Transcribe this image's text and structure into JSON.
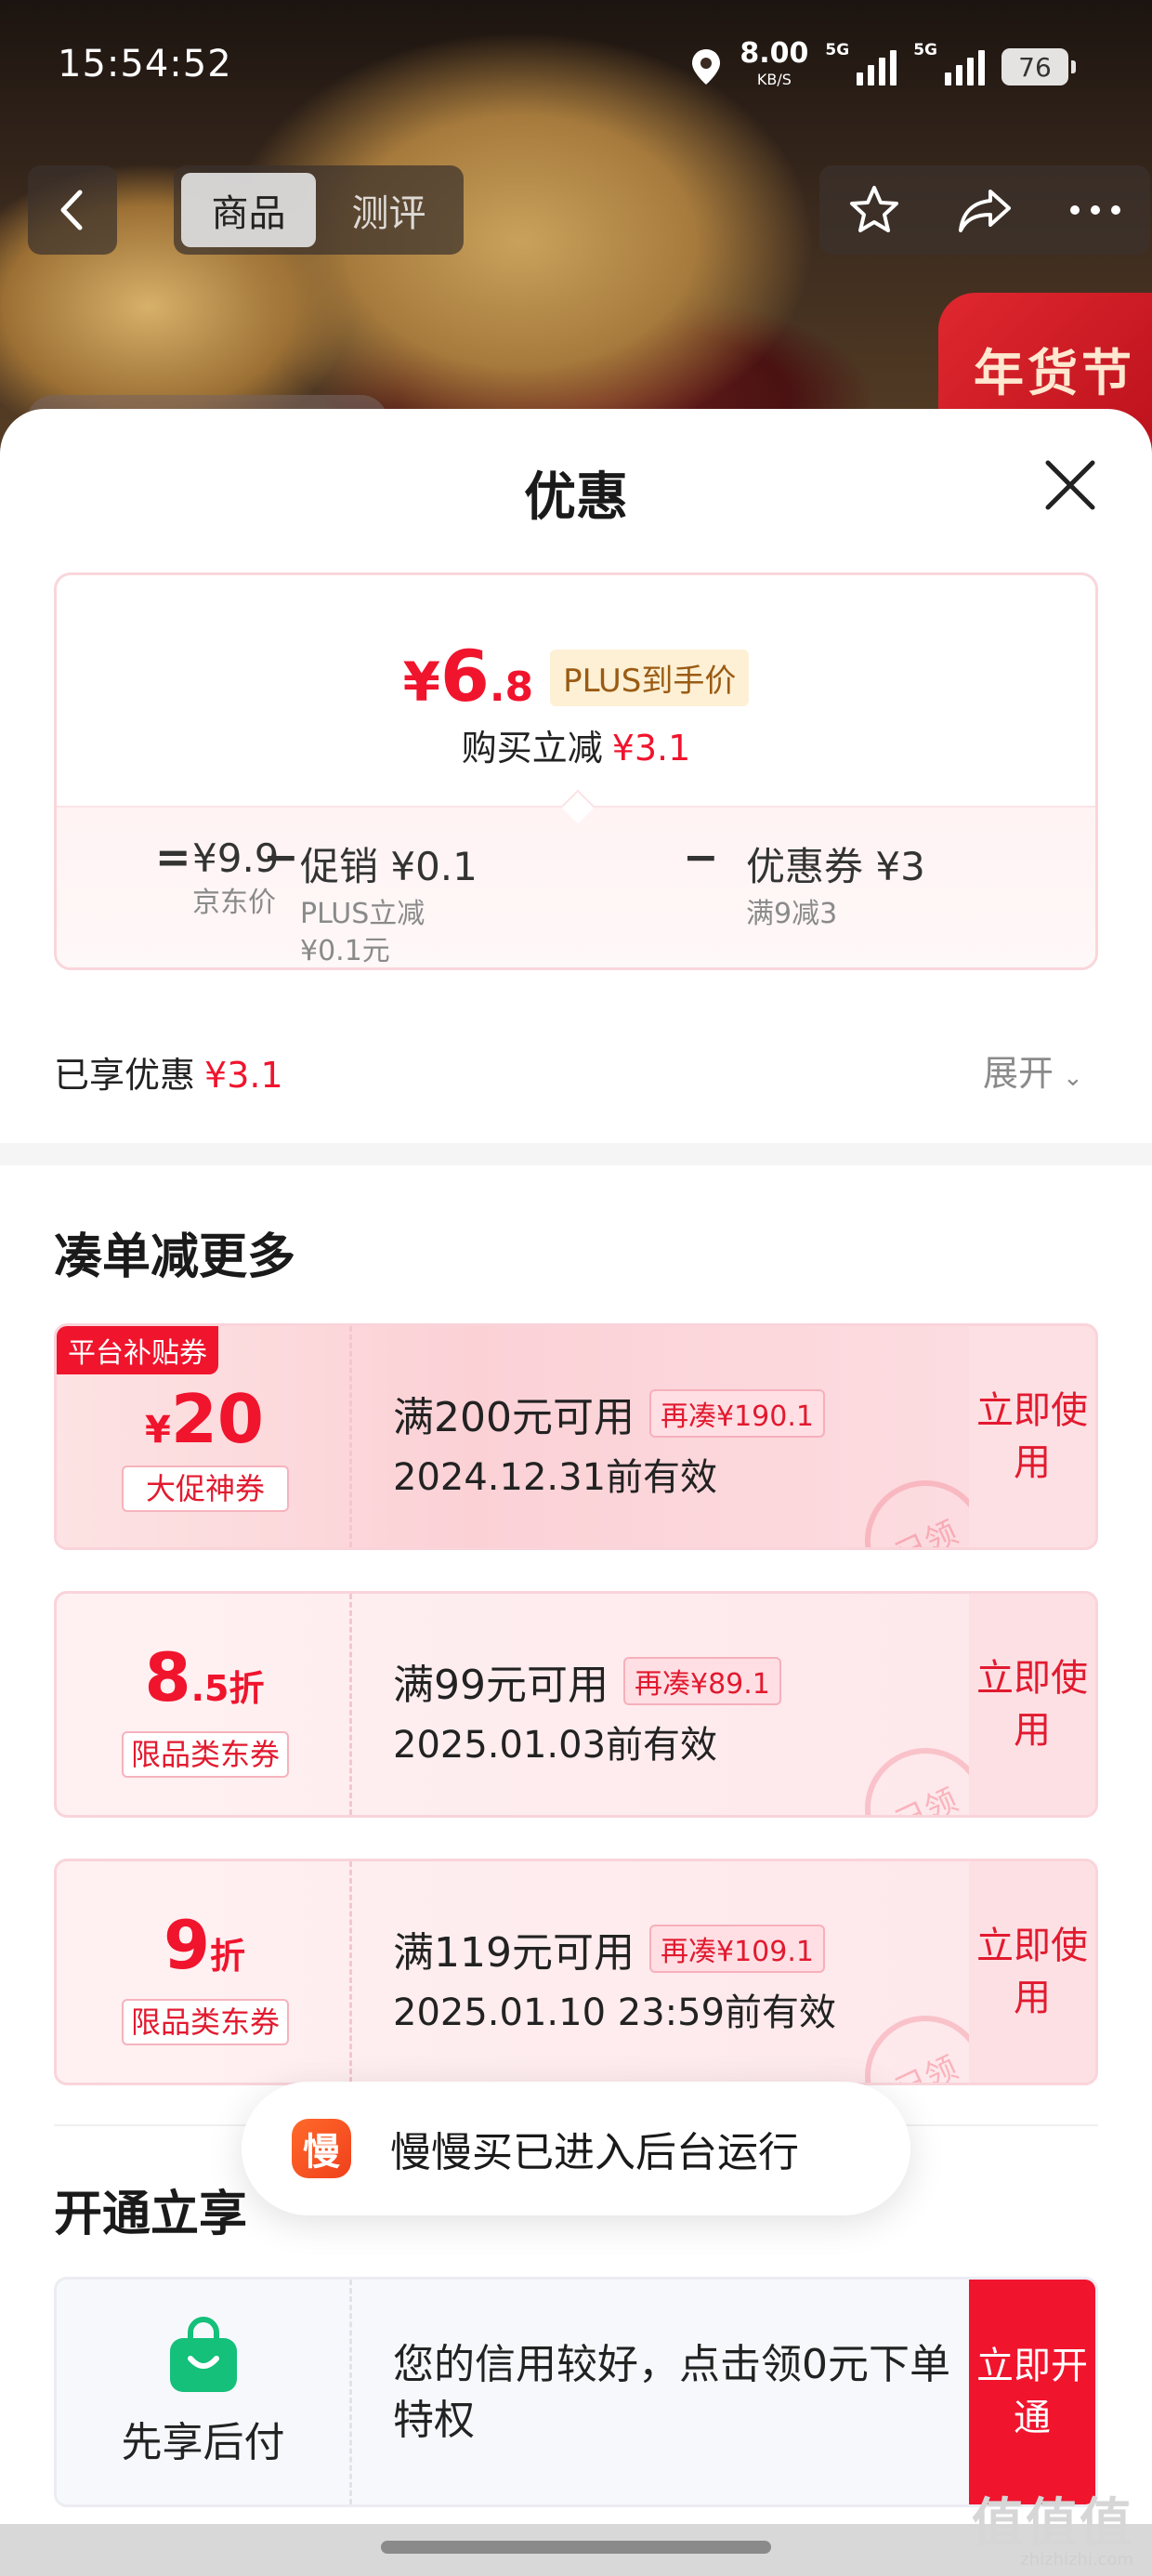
{
  "status_bar": {
    "time": "15:54:52",
    "speed_value": "8.00",
    "speed_unit": "KB/S",
    "net1": "5G",
    "net2": "5G",
    "battery": "76"
  },
  "nav": {
    "tabs": [
      {
        "label": "商品",
        "active": true
      },
      {
        "label": "测评",
        "active": false
      }
    ]
  },
  "backdrop": {
    "promo_text": "年货节"
  },
  "sheet": {
    "title": "优惠",
    "price_card": {
      "yen": "¥",
      "price_int": "6",
      "price_dec": ".8",
      "plus_tag": "PLUS到手价",
      "instant_label": "购买立减",
      "instant_value": "¥3.1",
      "formula": {
        "eq": "=",
        "base_value": "¥9.9",
        "base_label": "京东价",
        "minus1": "−",
        "promo_value": "促销 ¥0.1",
        "promo_label1": "PLUS立减",
        "promo_label2": "¥0.1元",
        "minus2": "−",
        "coupon_value": "优惠券 ¥3",
        "coupon_label": "满9减3"
      }
    },
    "saved_label": "已享优惠",
    "saved_value": "¥3.1",
    "expand_label": "展开",
    "section_more": "凑单减更多",
    "coupons": [
      {
        "tag": "平台补贴券",
        "value_prefix": "¥",
        "value_main": "20",
        "value_suffix": "",
        "badge": "大促神券",
        "condition": "满200元可用",
        "extra": "再凑¥190.1",
        "valid": "2024.12.31前有效",
        "stamp": "已领",
        "action": "立即使用"
      },
      {
        "tag": "",
        "value_prefix": "",
        "value_main": "8",
        "value_suffix": ".5折",
        "badge": "限品类东券",
        "condition": "满99元可用",
        "extra": "再凑¥89.1",
        "valid": "2025.01.03前有效",
        "stamp": "已领",
        "action": "立即使用"
      },
      {
        "tag": "",
        "value_prefix": "",
        "value_main": "9",
        "value_suffix": "折",
        "badge": "限品类东券",
        "condition": "满119元可用",
        "extra": "再凑¥109.1",
        "valid": "2025.01.10 23:59前有效",
        "stamp": "已领",
        "action": "立即使用"
      }
    ],
    "section_open": "开通立享",
    "bnpl": {
      "name": "先享后付",
      "text": "您的信用较好，点击领0元下单特权",
      "action": "立即开通"
    }
  },
  "toast": {
    "icon_text": "慢",
    "message": "慢慢买已进入后台运行"
  },
  "watermark": {
    "big": "值值值",
    "small": "zhizhizhi.com"
  },
  "colors": {
    "accent_red": "#f0142d",
    "plus_gold": "#9a5b14"
  }
}
